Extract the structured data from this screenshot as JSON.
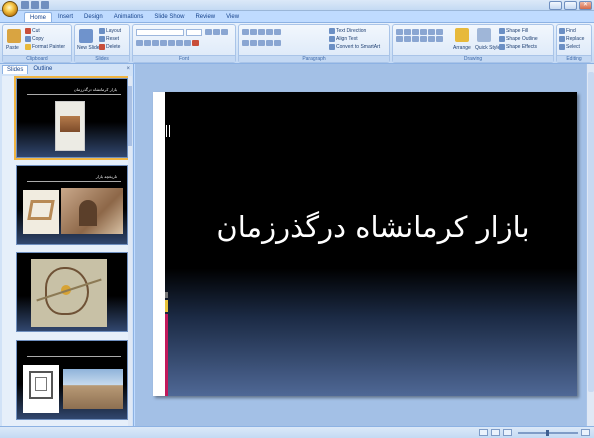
{
  "window": {
    "title": "",
    "buttons": [
      "",
      "",
      "✕"
    ]
  },
  "tabs": [
    "Home",
    "Insert",
    "Design",
    "Animations",
    "Slide Show",
    "Review",
    "View"
  ],
  "ribbon": {
    "groups": {
      "clipboard": {
        "label": "Clipboard",
        "paste": "Paste",
        "cut": "Cut",
        "copy": "Copy",
        "format_painter": "Format Painter"
      },
      "slides": {
        "label": "Slides",
        "new_slide": "New Slide",
        "layout": "Layout",
        "reset": "Reset",
        "delete": "Delete"
      },
      "font": {
        "label": "Font"
      },
      "paragraph": {
        "label": "Paragraph",
        "text_direction": "Text Direction",
        "align_text": "Align Text",
        "convert_smartart": "Convert to SmartArt"
      },
      "drawing": {
        "label": "Drawing",
        "arrange": "Arrange",
        "quick_styles": "Quick Styles",
        "shape_fill": "Shape Fill",
        "shape_outline": "Shape Outline",
        "shape_effects": "Shape Effects"
      },
      "editing": {
        "label": "Editing",
        "find": "Find",
        "replace": "Replace",
        "select": "Select"
      }
    }
  },
  "pane": {
    "tabs": [
      "Slides",
      "Outline"
    ],
    "close": "×",
    "slides": [
      {
        "num": "",
        "title": "بازار کرمانشاه درگذرزمان"
      },
      {
        "num": "",
        "title": "تاریخچه بازار"
      },
      {
        "num": "",
        "title": ""
      },
      {
        "num": "",
        "title": ""
      }
    ]
  },
  "slide": {
    "title": "بازار کرمانشاه درگذرزمان"
  },
  "status": {
    "slide_indicator": "",
    "theme": "",
    "language": "",
    "zoom": ""
  },
  "colors": {
    "ribbon_bg": "#d6e6f8",
    "slide_bg": "#000000",
    "accent_magenta": "#c2185b",
    "accent_yellow": "#e7c23a"
  }
}
